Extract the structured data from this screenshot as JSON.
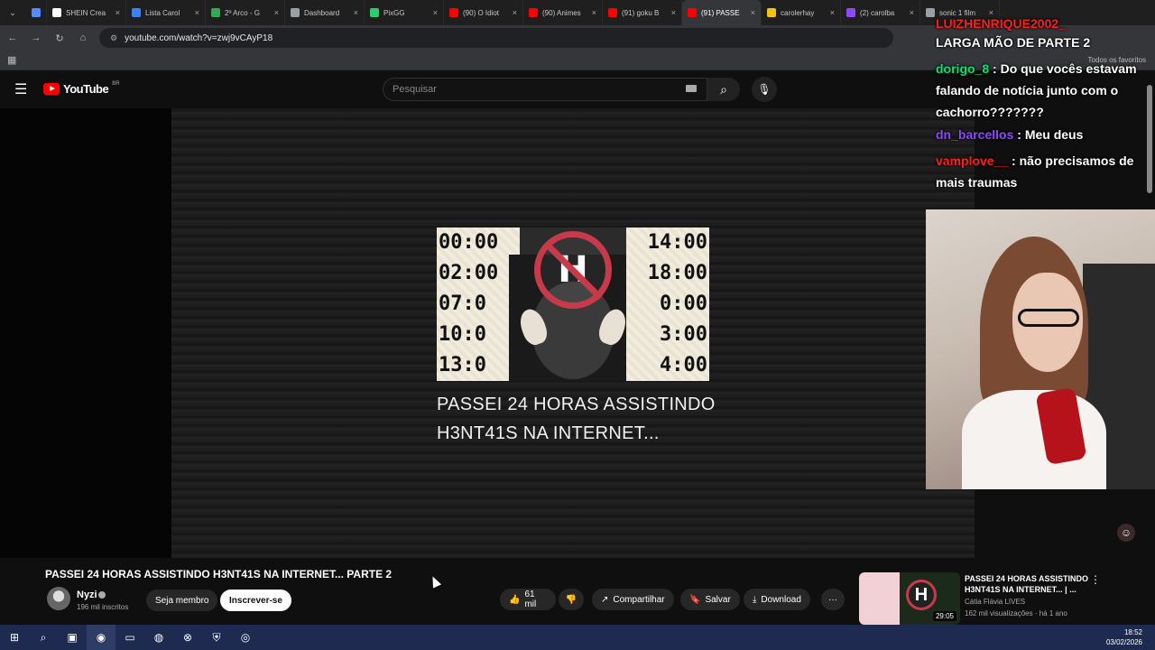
{
  "browser": {
    "tabs": [
      {
        "label": "",
        "color": "#4f8cff",
        "pinned": true
      },
      {
        "label": "SHEIN Crea",
        "color": "#ffffff"
      },
      {
        "label": "Lista Carol",
        "color": "#3b82f6"
      },
      {
        "label": "2º Arco - G",
        "color": "#34a853"
      },
      {
        "label": "Dashboard",
        "color": "#9aa0a6"
      },
      {
        "label": "PixGG",
        "color": "#2ecc71"
      },
      {
        "label": "(90) O Idiot",
        "color": "#ff0000"
      },
      {
        "label": "(90) Animes",
        "color": "#ff0000"
      },
      {
        "label": "(91) goku B",
        "color": "#ff0000"
      },
      {
        "label": "(91) PASSE",
        "color": "#ff0000",
        "active": true
      },
      {
        "label": "carolerhay",
        "color": "#f4c20d"
      },
      {
        "label": "(2) carolba",
        "color": "#9147ff"
      },
      {
        "label": "sonic 1 film",
        "color": "#9aa0a6"
      }
    ],
    "url": "youtube.com/watch?v=zwj9vCAyP18",
    "bookmarks_all": "Todos os favoritos"
  },
  "youtube": {
    "logo": "YouTube",
    "country": "BR",
    "search_placeholder": "Pesquisar"
  },
  "video": {
    "thumb_times_left": [
      "00:00",
      "02:00",
      "07:0",
      "10:0",
      "13:0"
    ],
    "thumb_times_right": [
      "14:00",
      "18:00",
      "0:00",
      "3:00",
      "4:00"
    ],
    "thumb_letter": "H",
    "caption_line1": "PASSEI 24 HORAS ASSISTINDO",
    "caption_line2": "H3NT41S NA INTERNET...",
    "title": "PASSEI 24 HORAS ASSISTINDO H3NT41S NA INTERNET... PARTE 2",
    "channel": "Nyzi",
    "subscribers": "196 mil inscritos",
    "join_label": "Seja membro",
    "subscribe_label": "Inscrever-se",
    "likes": "61 mil",
    "share_label": "Compartilhar",
    "save_label": "Salvar",
    "download_label": "Download",
    "more_label": "···"
  },
  "chat": {
    "messages": [
      {
        "user": "LUIZHENRIQUE2002_",
        "text": "LARGA MÃO DE PARTE 2"
      },
      {
        "user": "dorigo_8",
        "text": "Do que vocês estavam falando de notícia junto com o cachorro???????"
      },
      {
        "user": "dn_barcellos",
        "text": "Meu deus"
      },
      {
        "user": "vamplove__",
        "text": "não precisamos de mais traumas"
      }
    ],
    "colors": {
      "user1": "#ff1f1f",
      "user2": "#00e676",
      "user3": "#9147ff",
      "user4": "#ff1f1f"
    }
  },
  "recommendation": {
    "title": "PASSEI 24 HORAS ASSISTINDO H3NT41S NA INTERNET... | ...",
    "channel": "Cátia Flávia LIVES",
    "meta": "162 mil visualizações · há 1 ano",
    "duration": "29:05",
    "thumb_letter": "H"
  },
  "taskbar": {
    "time": "18:52",
    "date": "03/02/2026"
  }
}
